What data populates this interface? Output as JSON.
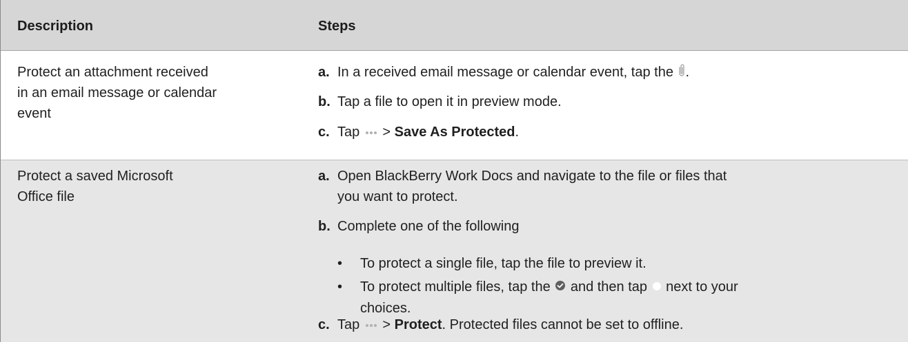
{
  "header": {
    "col1": "Description",
    "col2": "Steps"
  },
  "rows": [
    {
      "desc_lines": [
        "Protect an attachment received",
        "in an email message or calendar",
        "event"
      ],
      "steps": [
        {
          "letter": "a.",
          "text": "In a received email message or calendar event, tap the",
          "after_icon": "."
        },
        {
          "letter": "b.",
          "text": "Tap a file to open it in preview mode."
        },
        {
          "letter": "c.",
          "pre": "Tap",
          "mid": ">",
          "bold": "Save As Protected",
          "post": "."
        }
      ]
    },
    {
      "desc_lines": [
        "Protect a saved Microsoft",
        "Office file"
      ],
      "steps": [
        {
          "letter": "a.",
          "line1": "Open BlackBerry Work  Docs and navigate to the file or files that",
          "line2": "you want to protect."
        },
        {
          "letter": "b.",
          "text": "Complete one of the following"
        },
        {
          "letter": "c.",
          "pre": "Tap",
          "mid": ">",
          "bold": "Protect",
          "post": ".  Protected files cannot be set to offline."
        }
      ],
      "bullets": [
        {
          "text": "To protect a single file, tap the file to preview it."
        },
        {
          "pre": "To protect multiple files, tap the",
          "mid": "and then tap",
          "post": "next to your",
          "line2": "choices."
        }
      ]
    }
  ],
  "icons": {
    "attachment": "paperclip-icon",
    "more": "more-dots-icon",
    "select": "check-circle-icon",
    "select_empty": "empty-circle-icon"
  },
  "colors": {
    "header_bg": "#d6d6d6",
    "alt_row_bg": "#e6e6e6"
  }
}
